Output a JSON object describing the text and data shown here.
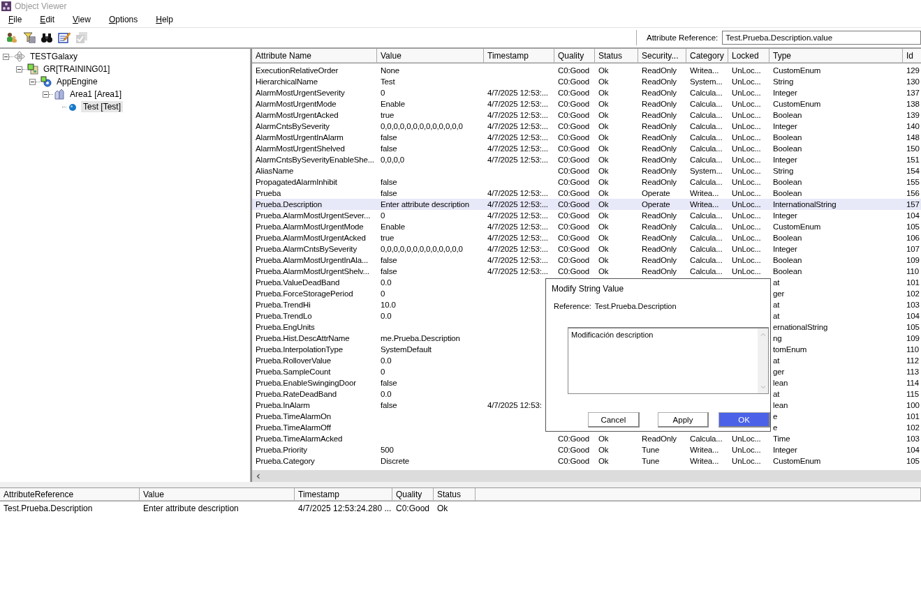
{
  "window": {
    "title": "Object Viewer"
  },
  "menu": [
    {
      "label": "File"
    },
    {
      "label": "Edit"
    },
    {
      "label": "View"
    },
    {
      "label": "Options"
    },
    {
      "label": "Help"
    }
  ],
  "toolbar": {
    "buttons": [
      {
        "kind": "people",
        "disabled": false
      },
      {
        "kind": "filter",
        "disabled": false
      },
      {
        "kind": "binoculars",
        "disabled": false
      },
      {
        "kind": "edit",
        "disabled": false
      },
      {
        "kind": "check",
        "disabled": true
      }
    ],
    "attribute_reference": {
      "label": "Attribute Reference:",
      "value": "Test.Prueba.Description.value"
    }
  },
  "tree": [
    {
      "label": "TESTGalaxy",
      "kind": "galaxy",
      "expanded": true,
      "selected": false,
      "children": [
        {
          "label": "GR[TRAINING01]",
          "kind": "platform",
          "expanded": true,
          "selected": false,
          "children": [
            {
              "label": "AppEngine",
              "kind": "engine",
              "expanded": true,
              "selected": false,
              "children": [
                {
                  "label": "Area1 [Area1]",
                  "kind": "area",
                  "expanded": true,
                  "selected": false,
                  "children": [
                    {
                      "label": "Test [Test]",
                      "kind": "object",
                      "selected": true
                    }
                  ]
                }
              ]
            }
          ]
        }
      ]
    }
  ],
  "table": {
    "columns": [
      "Attribute Name",
      "Value",
      "Timestamp",
      "Quality",
      "Status",
      "Security...",
      "Category",
      "Locked",
      "Type",
      "Id"
    ],
    "rows": [
      {
        "name": "ExecutionRelativeOrder",
        "value": "None",
        "quality": "C0:Good",
        "status": "Ok",
        "security": "ReadOnly",
        "category": "Writea...",
        "locked": "UnLoc...",
        "type": "CustomEnum",
        "id": "129",
        "selected": false
      },
      {
        "name": "HierarchicalName",
        "value": "Test",
        "quality": "C0:Good",
        "status": "Ok",
        "security": "ReadOnly",
        "category": "System...",
        "locked": "UnLoc...",
        "type": "String",
        "id": "130",
        "selected": false
      },
      {
        "name": "AlarmMostUrgentSeverity",
        "value": "0",
        "timestamp": "4/7/2025 12:53:...",
        "quality": "C0:Good",
        "status": "Ok",
        "security": "ReadOnly",
        "category": "Calcula...",
        "locked": "UnLoc...",
        "type": "Integer",
        "id": "137",
        "selected": false
      },
      {
        "name": "AlarmMostUrgentMode",
        "value": "Enable",
        "timestamp": "4/7/2025 12:53:...",
        "quality": "C0:Good",
        "status": "Ok",
        "security": "ReadOnly",
        "category": "Calcula...",
        "locked": "UnLoc...",
        "type": "CustomEnum",
        "id": "138",
        "selected": false
      },
      {
        "name": "AlarmMostUrgentAcked",
        "value": "true",
        "timestamp": "4/7/2025 12:53:...",
        "quality": "C0:Good",
        "status": "Ok",
        "security": "ReadOnly",
        "category": "Calcula...",
        "locked": "UnLoc...",
        "type": "Boolean",
        "id": "139",
        "selected": false
      },
      {
        "name": "AlarmCntsBySeverity",
        "value": "0,0,0,0,0,0,0,0,0,0,0,0,0",
        "timestamp": "4/7/2025 12:53:...",
        "quality": "C0:Good",
        "status": "Ok",
        "security": "ReadOnly",
        "category": "Calcula...",
        "locked": "UnLoc...",
        "type": "Integer",
        "id": "140",
        "selected": false
      },
      {
        "name": "AlarmMostUrgentInAlarm",
        "value": "false",
        "timestamp": "4/7/2025 12:53:...",
        "quality": "C0:Good",
        "status": "Ok",
        "security": "ReadOnly",
        "category": "Calcula...",
        "locked": "UnLoc...",
        "type": "Boolean",
        "id": "148",
        "selected": false
      },
      {
        "name": "AlarmMostUrgentShelved",
        "value": "false",
        "timestamp": "4/7/2025 12:53:...",
        "quality": "C0:Good",
        "status": "Ok",
        "security": "ReadOnly",
        "category": "Calcula...",
        "locked": "UnLoc...",
        "type": "Boolean",
        "id": "150",
        "selected": false
      },
      {
        "name": "AlarmCntsBySeverityEnableShe...",
        "value": "0,0,0,0",
        "timestamp": "4/7/2025 12:53:...",
        "quality": "C0:Good",
        "status": "Ok",
        "security": "ReadOnly",
        "category": "Calcula...",
        "locked": "UnLoc...",
        "type": "Integer",
        "id": "151",
        "selected": false
      },
      {
        "name": "AliasName",
        "quality": "C0:Good",
        "status": "Ok",
        "security": "ReadOnly",
        "category": "System...",
        "locked": "UnLoc...",
        "type": "String",
        "id": "154",
        "selected": false
      },
      {
        "name": "PropagatedAlarmInhibit",
        "value": "false",
        "quality": "C0:Good",
        "status": "Ok",
        "security": "ReadOnly",
        "category": "Calcula...",
        "locked": "UnLoc...",
        "type": "Boolean",
        "id": "155",
        "selected": false
      },
      {
        "name": "Prueba",
        "value": "false",
        "timestamp": "4/7/2025 12:53:...",
        "quality": "C0:Good",
        "status": "Ok",
        "security": "Operate",
        "category": "Writea...",
        "locked": "UnLoc...",
        "type": "Boolean",
        "id": "156",
        "selected": false
      },
      {
        "name": "Prueba.Description",
        "value": "Enter attribute description",
        "timestamp": "4/7/2025 12:53:...",
        "quality": "C0:Good",
        "status": "Ok",
        "security": "Operate",
        "category": "Writea...",
        "locked": "UnLoc...",
        "type": "InternationalString",
        "id": "157",
        "selected": true
      },
      {
        "name": "Prueba.AlarmMostUrgentSever...",
        "value": "0",
        "timestamp": "4/7/2025 12:53:...",
        "quality": "C0:Good",
        "status": "Ok",
        "security": "ReadOnly",
        "category": "Calcula...",
        "locked": "UnLoc...",
        "type": "Integer",
        "id": "104",
        "selected": false
      },
      {
        "name": "Prueba.AlarmMostUrgentMode",
        "value": "Enable",
        "timestamp": "4/7/2025 12:53:...",
        "quality": "C0:Good",
        "status": "Ok",
        "security": "ReadOnly",
        "category": "Calcula...",
        "locked": "UnLoc...",
        "type": "CustomEnum",
        "id": "105",
        "selected": false
      },
      {
        "name": "Prueba.AlarmMostUrgentAcked",
        "value": "true",
        "timestamp": "4/7/2025 12:53:...",
        "quality": "C0:Good",
        "status": "Ok",
        "security": "ReadOnly",
        "category": "Calcula...",
        "locked": "UnLoc...",
        "type": "Boolean",
        "id": "106",
        "selected": false
      },
      {
        "name": "Prueba.AlarmCntsBySeverity",
        "value": "0,0,0,0,0,0,0,0,0,0,0,0,0",
        "timestamp": "4/7/2025 12:53:...",
        "quality": "C0:Good",
        "status": "Ok",
        "security": "ReadOnly",
        "category": "Calcula...",
        "locked": "UnLoc...",
        "type": "Integer",
        "id": "107",
        "selected": false
      },
      {
        "name": "Prueba.AlarmMostUrgentInAla...",
        "value": "false",
        "timestamp": "4/7/2025 12:53:...",
        "quality": "C0:Good",
        "status": "Ok",
        "security": "ReadOnly",
        "category": "Calcula...",
        "locked": "UnLoc...",
        "type": "Boolean",
        "id": "109",
        "selected": false
      },
      {
        "name": "Prueba.AlarmMostUrgentShelv...",
        "value": "false",
        "timestamp": "4/7/2025 12:53:...",
        "quality": "C0:Good",
        "status": "Ok",
        "security": "ReadOnly",
        "category": "Calcula...",
        "locked": "UnLoc...",
        "type": "Boolean",
        "id": "110",
        "selected": false
      },
      {
        "name": "Prueba.ValueDeadBand",
        "value": "0.0",
        "type": "at",
        "id": "101",
        "selected": false
      },
      {
        "name": "Prueba.ForceStoragePeriod",
        "value": "0",
        "type": "ger",
        "id": "102",
        "selected": false
      },
      {
        "name": "Prueba.TrendHi",
        "value": "10.0",
        "type": "at",
        "id": "103",
        "selected": false
      },
      {
        "name": "Prueba.TrendLo",
        "value": "0.0",
        "type": "at",
        "id": "104",
        "selected": false
      },
      {
        "name": "Prueba.EngUnits",
        "type": "ernationalString",
        "id": "105",
        "selected": false
      },
      {
        "name": "Prueba.Hist.DescAttrName",
        "value": "me.Prueba.Description",
        "type": "ng",
        "id": "109",
        "selected": false
      },
      {
        "name": "Prueba.InterpolationType",
        "value": "SystemDefault",
        "type": "tomEnum",
        "id": "110",
        "selected": false
      },
      {
        "name": "Prueba.RolloverValue",
        "value": "0.0",
        "type": "at",
        "id": "112",
        "selected": false
      },
      {
        "name": "Prueba.SampleCount",
        "value": "0",
        "type": "ger",
        "id": "113",
        "selected": false
      },
      {
        "name": "Prueba.EnableSwingingDoor",
        "value": "false",
        "type": "lean",
        "id": "114",
        "selected": false
      },
      {
        "name": "Prueba.RateDeadBand",
        "value": "0.0",
        "type": "at",
        "id": "115",
        "selected": false
      },
      {
        "name": "Prueba.InAlarm",
        "value": "false",
        "timestamp": "4/7/2025 12:53:",
        "type": "lean",
        "id": "100",
        "selected": false
      },
      {
        "name": "Prueba.TimeAlarmOn",
        "type": "e",
        "id": "101",
        "selected": false
      },
      {
        "name": "Prueba.TimeAlarmOff",
        "type": "e",
        "id": "102",
        "selected": false
      },
      {
        "name": "Prueba.TimeAlarmAcked",
        "quality": "C0:Good",
        "status": "Ok",
        "security": "ReadOnly",
        "category": "Calcula...",
        "locked": "UnLoc...",
        "type": "Time",
        "id": "103",
        "selected": false
      },
      {
        "name": "Prueba.Priority",
        "value": "500",
        "quality": "C0:Good",
        "status": "Ok",
        "security": "Tune",
        "category": "Writea...",
        "locked": "UnLoc...",
        "type": "Integer",
        "id": "104",
        "selected": false
      },
      {
        "name": "Prueba.Category",
        "value": "Discrete",
        "quality": "C0:Good",
        "status": "Ok",
        "security": "Tune",
        "category": "Writea...",
        "locked": "UnLoc...",
        "type": "CustomEnum",
        "id": "105",
        "selected": false
      }
    ]
  },
  "watch": {
    "columns": [
      "AttributeReference",
      "Value",
      "Timestamp",
      "Quality",
      "Status"
    ],
    "rows": [
      {
        "cells": [
          "Test.Prueba.Description",
          "Enter attribute description",
          "4/7/2025 12:53:24.280 ...",
          "C0:Good",
          "Ok"
        ]
      }
    ]
  },
  "dialog": {
    "title": "Modify String Value",
    "reference_label": "Reference:",
    "reference": "Test.Prueba.Description",
    "value": "Modificación description",
    "buttons": [
      {
        "label": "Cancel",
        "primary": false
      },
      {
        "label": "Apply",
        "primary": false
      },
      {
        "label": "OK",
        "primary": true
      }
    ]
  }
}
